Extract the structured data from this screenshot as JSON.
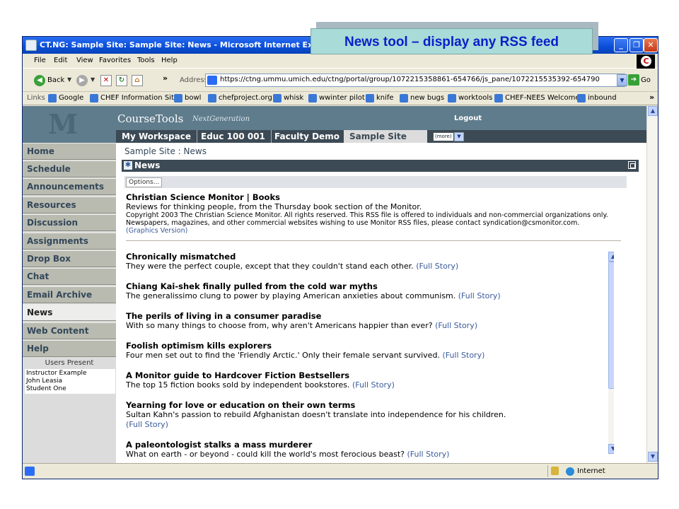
{
  "callout": "News tool – display any RSS feed",
  "window": {
    "title": "CT.NG: Sample Site: Sample Site: News - Microsoft Internet Explorer pro",
    "controls": {
      "minimize": "_",
      "maximize": "❐",
      "close": "✕"
    }
  },
  "menu": [
    "File",
    "Edit",
    "View",
    "Favorites",
    "Tools",
    "Help"
  ],
  "toolbar": {
    "back_label": "Back",
    "address_label": "Address",
    "url": "https://ctng.ummu.umich.edu/ctng/portal/group/1072215358861-654766/js_pane/1072215535392-654790",
    "go_label": "Go"
  },
  "links": {
    "label": "Links",
    "items": [
      "Google",
      "CHEF Information Site",
      "bowl",
      "chefproject.org",
      "whisk",
      "wwinter pilot",
      "knife",
      "new bugs",
      "worktools",
      "CHEF-NEES Welcome",
      "inbound"
    ]
  },
  "site": {
    "brand": "CourseTools",
    "brand_sub": "NextGeneration",
    "logo_letter": "M",
    "logout": "Logout",
    "tabs": [
      "My Workspace",
      "Educ 100 001",
      "Faculty Demo",
      "Sample Site"
    ],
    "more": "(more)"
  },
  "tool_nav": [
    "Home",
    "Schedule",
    "Announcements",
    "Resources",
    "Discussion",
    "Assignments",
    "Drop Box",
    "Chat",
    "Email Archive",
    "News",
    "Web Content",
    "Help"
  ],
  "users_present": {
    "label": "Users Present",
    "users": [
      "Instructor Example",
      "John Leasia",
      "Student One"
    ]
  },
  "main": {
    "breadcrumb": "Sample Site :  News",
    "tool_title": "News",
    "options_label": "Options..."
  },
  "feed": {
    "title": "Christian Science Monitor | Books",
    "description": "Reviews for thinking people, from the Thursday book section of the Monitor.",
    "copyright": "Copyright 2003 The Christian Science Monitor. All rights reserved. This RSS file is offered to individuals and non-commercial organizations only. Newspapers, magazines, and other commercial websites wishing to use Monitor RSS files, please contact syndication@csmonitor.com.",
    "graphics_link": "(Graphics Version)",
    "full_story": "(Full Story)",
    "items": [
      {
        "title": "Chronically mismatched",
        "desc": "They were the perfect couple, except that they couldn't stand each other."
      },
      {
        "title": "Chiang Kai-shek finally pulled from the cold war myths",
        "desc": "The generalissimo clung to power by playing American anxieties about communism."
      },
      {
        "title": "The perils of living in a consumer paradise",
        "desc": "With so many things to choose from, why aren't Americans happier than ever?"
      },
      {
        "title": "Foolish optimism kills explorers",
        "desc": "Four men set out to find the 'Friendly Arctic.' Only their female servant survived."
      },
      {
        "title": "A Monitor guide to Hardcover Fiction Bestsellers",
        "desc": "The top 15 fiction books sold by independent bookstores."
      },
      {
        "title": "Yearning for love or education on their own terms",
        "desc": "Sultan Kahn's passion to rebuild Afghanistan doesn't translate into independence for his children."
      },
      {
        "title": "A paleontologist stalks a mass murderer",
        "desc": "What on earth - or beyond - could kill the world's most ferocious beast?"
      }
    ]
  },
  "status": {
    "zone": "Internet"
  }
}
